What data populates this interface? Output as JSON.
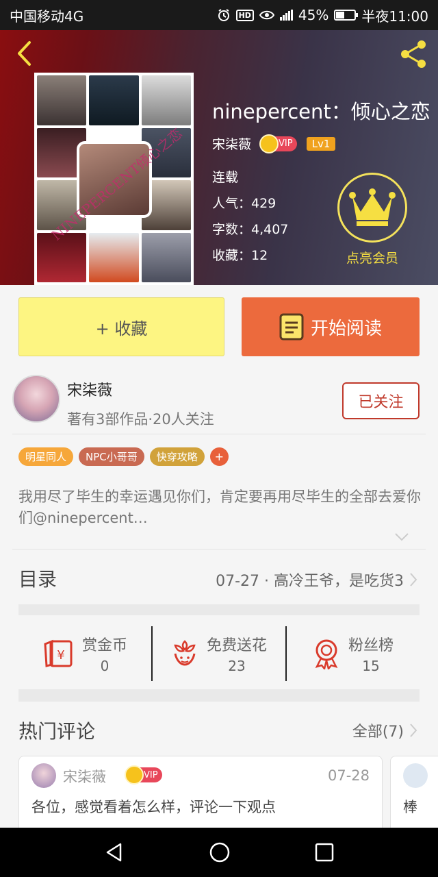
{
  "status_bar": {
    "carrier": "中国移动4G",
    "battery": "45%",
    "time": "半夜11:00",
    "network": "4G"
  },
  "book": {
    "title": "ninepercent：倾心之恋",
    "author": "宋柒薇",
    "vip_label": "VIP",
    "level": "Lv1",
    "status": "连载",
    "popularity": "人气：429",
    "word_count": "字数：4,407",
    "favorites": "收藏：12",
    "cover_watermark": "NINEPERCENT倾心之恋",
    "member_label": "点亮会员"
  },
  "actions": {
    "favorite_label": "+ 收藏",
    "read_label": "开始阅读"
  },
  "author_card": {
    "name": "宋柒薇",
    "info": "著有3部作品·20人关注",
    "follow_label": "已关注"
  },
  "tags": [
    "明星同人",
    "NPC小哥哥",
    "快穿攻略",
    "+"
  ],
  "description": "我用尽了毕生的幸运遇见你们，肯定要再用尽毕生的全部去爱你们@ninepercent…",
  "catalog": {
    "label": "目录",
    "latest": "07-27 · 高冷王爷，是吃货3"
  },
  "stats": [
    {
      "label": "赏金币",
      "value": "0",
      "icon": "coin-envelope-icon"
    },
    {
      "label": "免费送花",
      "value": "23",
      "icon": "flower-icon"
    },
    {
      "label": "粉丝榜",
      "value": "15",
      "icon": "medal-icon"
    }
  ],
  "comments": {
    "title": "热门评论",
    "all_label": "全部(7)",
    "items": [
      {
        "user": "宋柒薇",
        "vip": "VIP",
        "date": "07-28",
        "text": "各位，感觉看着怎么样，评论一下观点"
      },
      {
        "text": "棒"
      }
    ]
  },
  "colors": {
    "accent_orange": "#ec6a3d",
    "favorite_yellow": "#fdf582",
    "follow_red": "#c0392b",
    "member_gold": "#f6df42"
  }
}
